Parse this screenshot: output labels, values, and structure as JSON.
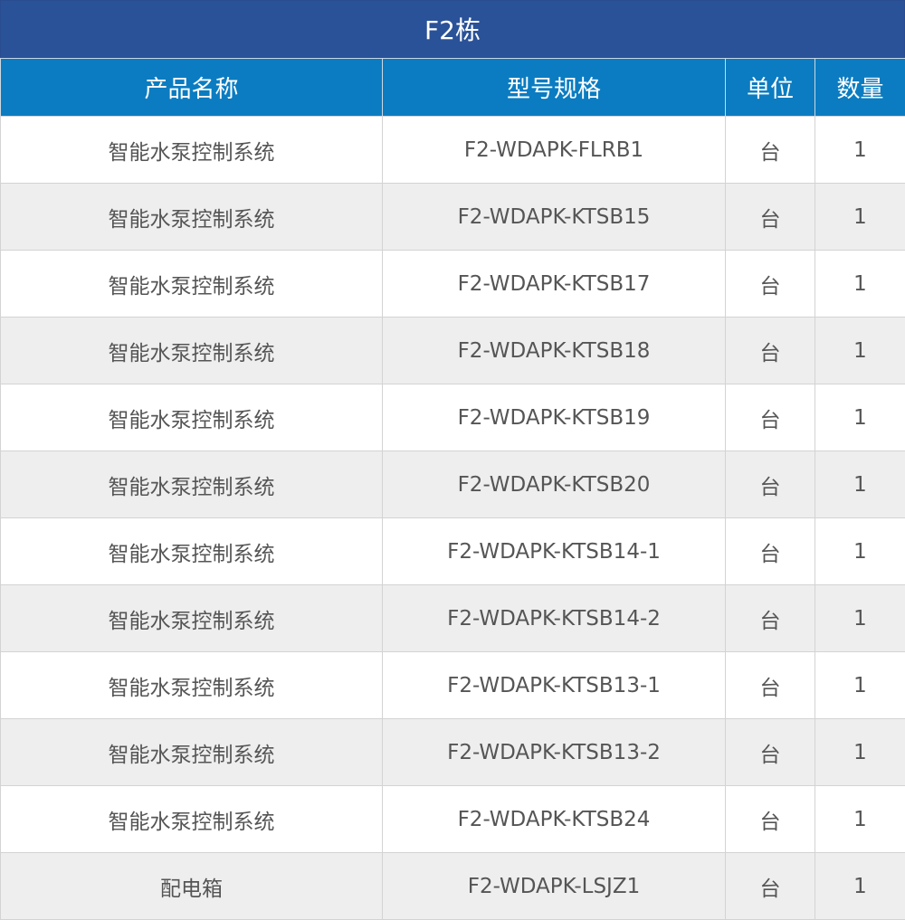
{
  "colors": {
    "title_bg": "#2a5298",
    "header_bg": "#0b7cc1",
    "row_alt_bg": "#eeeeee",
    "text": "#555555"
  },
  "table": {
    "title": "F2栋",
    "headers": [
      "产品名称",
      "型号规格",
      "单位",
      "数量"
    ],
    "rows": [
      [
        "智能水泵控制系统",
        "F2-WDAPK-FLRB1",
        "台",
        "1"
      ],
      [
        "智能水泵控制系统",
        "F2-WDAPK-KTSB15",
        "台",
        "1"
      ],
      [
        "智能水泵控制系统",
        "F2-WDAPK-KTSB17",
        "台",
        "1"
      ],
      [
        "智能水泵控制系统",
        "F2-WDAPK-KTSB18",
        "台",
        "1"
      ],
      [
        "智能水泵控制系统",
        "F2-WDAPK-KTSB19",
        "台",
        "1"
      ],
      [
        "智能水泵控制系统",
        "F2-WDAPK-KTSB20",
        "台",
        "1"
      ],
      [
        "智能水泵控制系统",
        "F2-WDAPK-KTSB14-1",
        "台",
        "1"
      ],
      [
        "智能水泵控制系统",
        "F2-WDAPK-KTSB14-2",
        "台",
        "1"
      ],
      [
        "智能水泵控制系统",
        "F2-WDAPK-KTSB13-1",
        "台",
        "1"
      ],
      [
        "智能水泵控制系统",
        "F2-WDAPK-KTSB13-2",
        "台",
        "1"
      ],
      [
        "智能水泵控制系统",
        "F2-WDAPK-KTSB24",
        "台",
        "1"
      ],
      [
        "配电箱",
        "F2-WDAPK-LSJZ1",
        "台",
        "1"
      ]
    ]
  }
}
